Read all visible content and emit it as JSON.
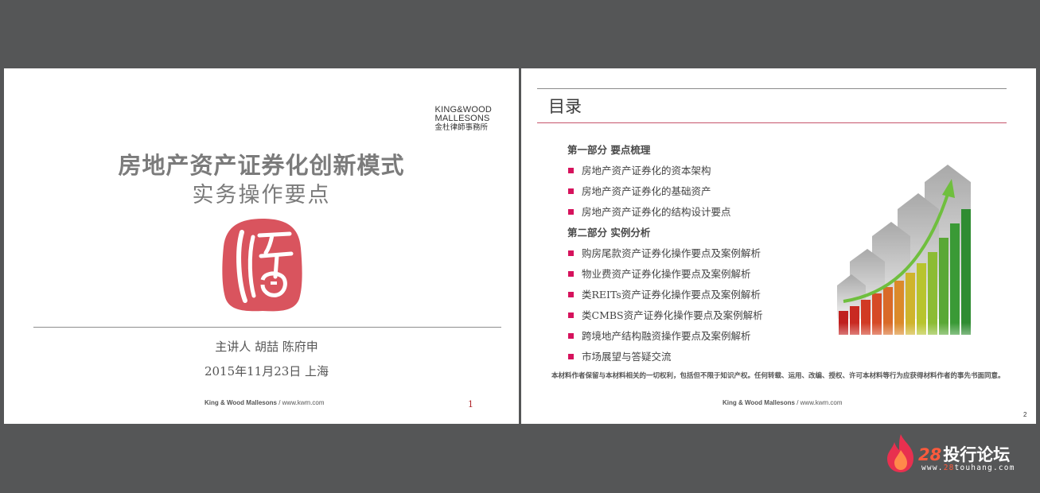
{
  "slide1": {
    "logo": {
      "line1": "KING&WOOD",
      "line2": "MALLESONS",
      "line3": "金杜律師事務所"
    },
    "title_line1": "房地产资产证券化创新模式",
    "title_line2": "实务操作要点",
    "presenters": "主讲人 胡喆 陈府申",
    "date_place": "2015年11月23日 上海",
    "footer_bold": "King & Wood Mallesons",
    "footer_rest": " / www.kwm.com",
    "page_number": "1"
  },
  "slide2": {
    "heading": "目录",
    "part1": "第一部分 要点梳理",
    "part1_items": [
      "房地产资产证券化的资本架构",
      "房地产资产证券化的基础资产",
      "房地产资产证券化的结构设计要点"
    ],
    "part2": "第二部分 实例分析",
    "part2_items": [
      "购房尾款资产证券化操作要点及案例解析",
      "物业费资产证券化操作要点及案例解析",
      "类REITs资产证券化操作要点及案例解析",
      "类CMBS资产证券化操作要点及案例解析",
      "跨境地产结构融资操作要点及案例解析",
      "市场展望与答疑交流"
    ],
    "notice": "本材料作者保留与本材料相关的一切权利，包括但不限于知识产权。任何转载、运用、改编、授权、许可本材料等行为应获得材料作者的事先书面同意。",
    "footer_bold": "King & Wood Mallesons",
    "footer_rest": " / www.kwm.com",
    "page_number": "2"
  },
  "watermark": {
    "number": "28",
    "text": "投行论坛",
    "url_prefix": "www.",
    "url_highlight": "28",
    "url_suffix": "touhang.com"
  },
  "colors": {
    "bullet": "#d6125c",
    "seal": "#d9545e",
    "background": "#555657"
  }
}
